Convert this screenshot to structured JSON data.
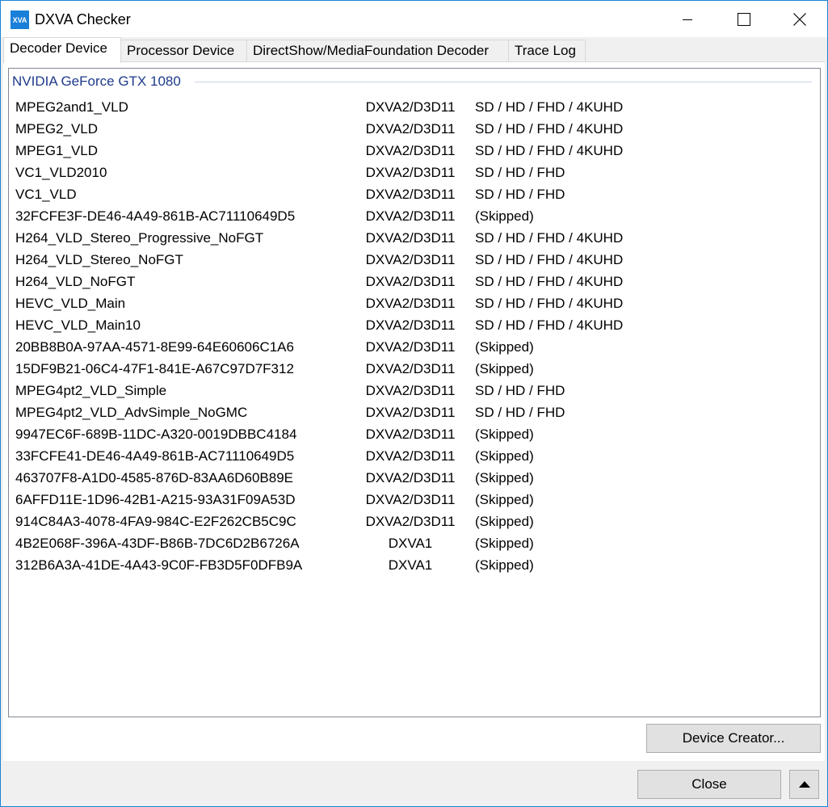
{
  "window": {
    "icon_text": "XVA",
    "title": "DXVA Checker",
    "accent_color": "#1883d7"
  },
  "tabs": [
    {
      "label": "Decoder Device",
      "active": true
    },
    {
      "label": "Processor Device",
      "active": false
    },
    {
      "label": "DirectShow/MediaFoundation Decoder",
      "active": false
    },
    {
      "label": "Trace Log",
      "active": false
    }
  ],
  "group": {
    "header": "NVIDIA GeForce GTX 1080"
  },
  "decoders": [
    {
      "name": "MPEG2and1_VLD",
      "api": "DXVA2/D3D11",
      "resolutions": "SD / HD / FHD / 4KUHD"
    },
    {
      "name": "MPEG2_VLD",
      "api": "DXVA2/D3D11",
      "resolutions": "SD / HD / FHD / 4KUHD"
    },
    {
      "name": "MPEG1_VLD",
      "api": "DXVA2/D3D11",
      "resolutions": "SD / HD / FHD / 4KUHD"
    },
    {
      "name": "VC1_VLD2010",
      "api": "DXVA2/D3D11",
      "resolutions": "SD / HD / FHD"
    },
    {
      "name": "VC1_VLD",
      "api": "DXVA2/D3D11",
      "resolutions": "SD / HD / FHD"
    },
    {
      "name": "32FCFE3F-DE46-4A49-861B-AC71110649D5",
      "api": "DXVA2/D3D11",
      "resolutions": "(Skipped)"
    },
    {
      "name": "H264_VLD_Stereo_Progressive_NoFGT",
      "api": "DXVA2/D3D11",
      "resolutions": "SD / HD / FHD / 4KUHD"
    },
    {
      "name": "H264_VLD_Stereo_NoFGT",
      "api": "DXVA2/D3D11",
      "resolutions": "SD / HD / FHD / 4KUHD"
    },
    {
      "name": "H264_VLD_NoFGT",
      "api": "DXVA2/D3D11",
      "resolutions": "SD / HD / FHD / 4KUHD"
    },
    {
      "name": "HEVC_VLD_Main",
      "api": "DXVA2/D3D11",
      "resolutions": "SD / HD / FHD / 4KUHD"
    },
    {
      "name": "HEVC_VLD_Main10",
      "api": "DXVA2/D3D11",
      "resolutions": "SD / HD / FHD / 4KUHD"
    },
    {
      "name": "20BB8B0A-97AA-4571-8E99-64E60606C1A6",
      "api": "DXVA2/D3D11",
      "resolutions": "(Skipped)"
    },
    {
      "name": "15DF9B21-06C4-47F1-841E-A67C97D7F312",
      "api": "DXVA2/D3D11",
      "resolutions": "(Skipped)"
    },
    {
      "name": "MPEG4pt2_VLD_Simple",
      "api": "DXVA2/D3D11",
      "resolutions": "SD / HD / FHD"
    },
    {
      "name": "MPEG4pt2_VLD_AdvSimple_NoGMC",
      "api": "DXVA2/D3D11",
      "resolutions": "SD / HD / FHD"
    },
    {
      "name": "9947EC6F-689B-11DC-A320-0019DBBC4184",
      "api": "DXVA2/D3D11",
      "resolutions": "(Skipped)"
    },
    {
      "name": "33FCFE41-DE46-4A49-861B-AC71110649D5",
      "api": "DXVA2/D3D11",
      "resolutions": "(Skipped)"
    },
    {
      "name": "463707F8-A1D0-4585-876D-83AA6D60B89E",
      "api": "DXVA2/D3D11",
      "resolutions": "(Skipped)"
    },
    {
      "name": "6AFFD11E-1D96-42B1-A215-93A31F09A53D",
      "api": "DXVA2/D3D11",
      "resolutions": "(Skipped)"
    },
    {
      "name": "914C84A3-4078-4FA9-984C-E2F262CB5C9C",
      "api": "DXVA2/D3D11",
      "resolutions": "(Skipped)"
    },
    {
      "name": "4B2E068F-396A-43DF-B86B-7DC6D2B6726A",
      "api": "DXVA1",
      "resolutions": "(Skipped)"
    },
    {
      "name": "312B6A3A-41DE-4A43-9C0F-FB3D5F0DFB9A",
      "api": "DXVA1",
      "resolutions": "(Skipped)"
    }
  ],
  "buttons": {
    "device_creator": "Device Creator...",
    "close": "Close"
  }
}
